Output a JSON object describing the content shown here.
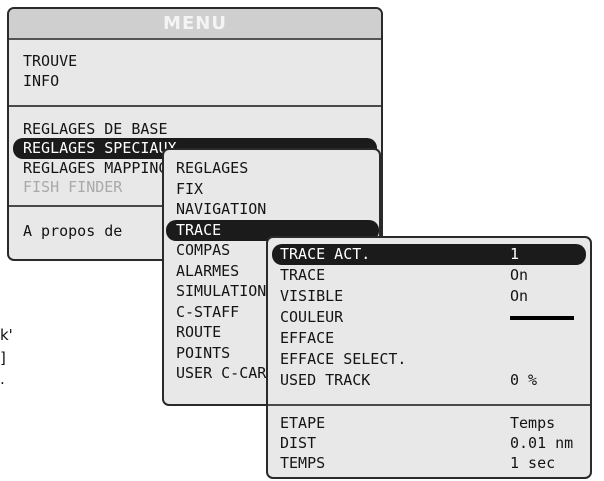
{
  "main_menu": {
    "title": "MENU",
    "items": [
      "TROUVE",
      "INFO",
      "REGLAGES DE BASE",
      "REGLAGES SPECIAUX",
      "REGLAGES MAPPING",
      "FISH FINDER"
    ],
    "footer": "A propos de"
  },
  "sub_menu": {
    "items": [
      "REGLAGES",
      "FIX",
      "NAVIGATION",
      "TRACE",
      "COMPAS",
      "ALARMES",
      "SIMULATION",
      "C-STAFF",
      "ROUTE",
      "POINTS",
      "USER C-CARD"
    ]
  },
  "trace_menu": {
    "rows": [
      {
        "label": "TRACE ACT.",
        "value": "1"
      },
      {
        "label": "TRACE",
        "value": "On"
      },
      {
        "label": "VISIBLE",
        "value": "On"
      },
      {
        "label": "COULEUR",
        "value": ""
      },
      {
        "label": "EFFACE",
        "value": ""
      },
      {
        "label": "EFFACE SELECT.",
        "value": ""
      },
      {
        "label": "USED TRACK",
        "value": "0 %"
      }
    ],
    "bottom_rows": [
      {
        "label": "ETAPE",
        "value": "Temps"
      },
      {
        "label": "DIST",
        "value": "0.01 nm"
      },
      {
        "label": "TEMPS",
        "value": "1 sec"
      }
    ],
    "colour_swatch": "#000000"
  },
  "side_notes": [
    "k'",
    "]",
    "."
  ]
}
